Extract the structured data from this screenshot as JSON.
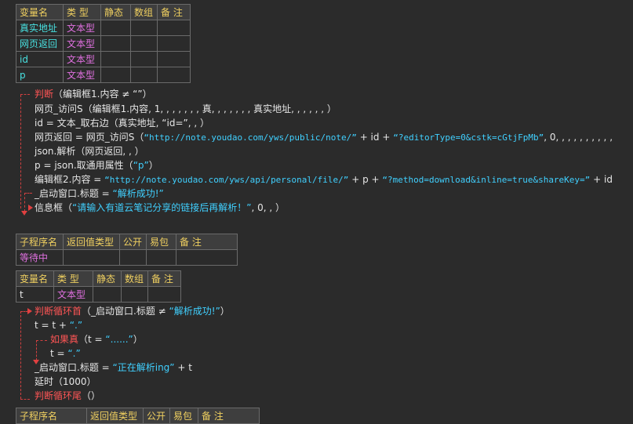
{
  "table1": {
    "headers": [
      "变量名",
      "类 型",
      "静态",
      "数组",
      "备 注"
    ],
    "rows": [
      [
        "真实地址",
        "文本型"
      ],
      [
        "网页返回",
        "文本型"
      ],
      [
        "id",
        "文本型"
      ],
      [
        "p",
        "文本型"
      ]
    ]
  },
  "code1": {
    "l1": {
      "kw": "判断",
      "rest": "（编辑框1.内容 ≠ “”）"
    },
    "l2": {
      "fn": "网页_访问S",
      "args": "（编辑框1.内容, 1, , , , , , , 真, , , , , , , 真实地址, , , , , , ）"
    },
    "l3": {
      "lhs": "id",
      "op": " = ",
      "fn": "文本_取右边",
      "args": "（真实地址, “id=”, , ）"
    },
    "l4": {
      "lhs": "网页返回",
      "op": " = ",
      "fn": "网页_访问S",
      "open": "（",
      "s1": "“http://note.youdao.com/yws/public/note/”",
      "plus1": " + id + ",
      "s2": "“?editorType=0&cstk=cGtjFpMb”",
      "tail": ", 0, , , , , , , , , ,"
    },
    "l5": {
      "fn": "json.解析",
      "args": "（网页返回, , ）"
    },
    "l6": {
      "lhs": "p",
      "op": " = ",
      "fn": "json.取通用属性",
      "open": "（",
      "s1": "“p”",
      "close": "）"
    },
    "l7": {
      "lhs": "编辑框2.内容",
      "op": " = ",
      "s1": "“http://note.youdao.com/yws/api/personal/file/”",
      "plus1": " + p + ",
      "s2": "“?method=download&inline=true&shareKey=”",
      "plus2": " + id"
    },
    "l8": {
      "lhs": "_启动窗口.标题",
      "op": " = ",
      "s1": "“解析成功!”"
    },
    "l9": {
      "fn": "信息框",
      "open": "（",
      "s1": "“请输入有道云笔记分享的链接后再解析！”",
      "tail": ", 0, , ）"
    }
  },
  "table2": {
    "headers": [
      "子程序名",
      "返回值类型",
      "公开",
      "易包",
      "备 注"
    ],
    "rows": [
      [
        "等待中"
      ]
    ]
  },
  "table3": {
    "headers": [
      "变量名",
      "类 型",
      "静态",
      "数组",
      "备 注"
    ],
    "rows": [
      [
        "t",
        "文本型"
      ]
    ]
  },
  "code2": {
    "l1": {
      "kw": "判断循环首",
      "open": "（",
      "lhs": "_启动窗口.标题",
      "op": " ≠ ",
      "s1": "“解析成功!”",
      "close": "）"
    },
    "l2": {
      "lhs": "t",
      "op": " = t + ",
      "s1": "“.”"
    },
    "l3": {
      "kw": "如果真",
      "open": "（t = ",
      "s1": "“......”",
      "close": "）"
    },
    "l4": {
      "lhs": "t",
      "op": " = ",
      "s1": "“.”"
    },
    "l5": {
      "lhs": "_启动窗口.标题",
      "op": " = ",
      "s1": "“正在解析ing”",
      "plus": " + t"
    },
    "l6": {
      "fn": "延时",
      "args": "（1000）"
    },
    "l7": {
      "kw": "判断循环尾",
      "args": "（）"
    }
  },
  "table4": {
    "headers": [
      "子程序名",
      "返回值类型",
      "公开",
      "易包",
      "备 注"
    ]
  }
}
